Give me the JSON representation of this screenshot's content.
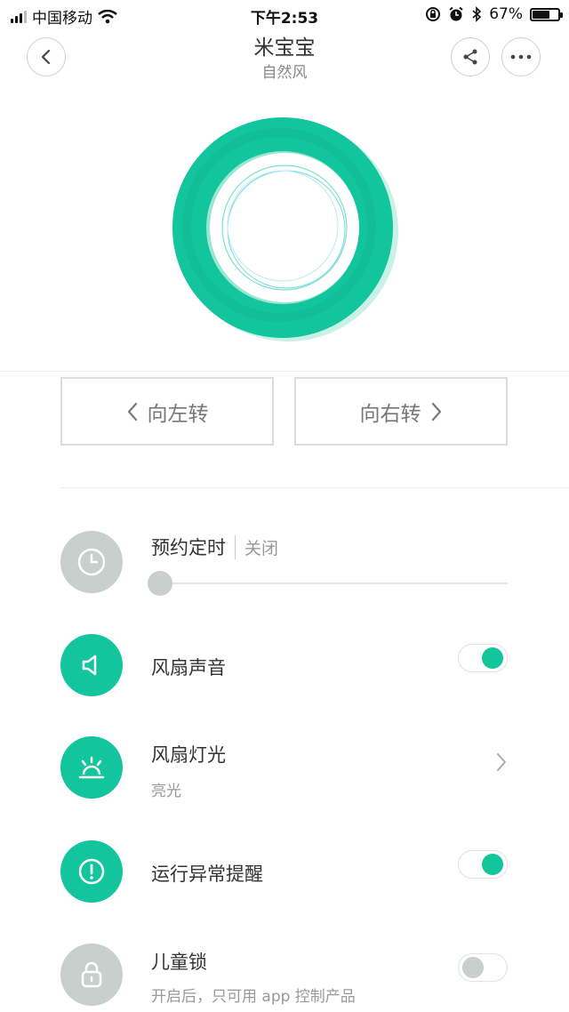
{
  "status_bar": {
    "carrier": "中国移动",
    "time": "下午2:53",
    "battery_percent": "67%",
    "battery_level": 0.67
  },
  "header": {
    "title": "米宝宝",
    "subtitle": "自然风"
  },
  "controls": {
    "turn_left": "向左转",
    "turn_right": "向右转"
  },
  "settings": {
    "timer": {
      "title": "预约定时",
      "status": "关闭",
      "slider_value": 0
    },
    "sound": {
      "title": "风扇声音",
      "enabled": true
    },
    "light": {
      "title": "风扇灯光",
      "subtitle": "亮光"
    },
    "alert": {
      "title": "运行异常提醒",
      "enabled": true
    },
    "child_lock": {
      "title": "儿童锁",
      "subtitle": "开启后，只可用 app 控制产品",
      "enabled": false
    }
  },
  "colors": {
    "accent": "#12c59c",
    "inactive": "#c8cfcc"
  },
  "icons": [
    "signal-icon",
    "wifi-icon",
    "lock-rotation-icon",
    "alarm-icon",
    "bluetooth-icon",
    "battery-icon",
    "back-icon",
    "share-icon",
    "more-icon",
    "clock-icon",
    "speaker-icon",
    "light-icon",
    "alert-icon",
    "lock-icon",
    "chevron-right-icon"
  ]
}
